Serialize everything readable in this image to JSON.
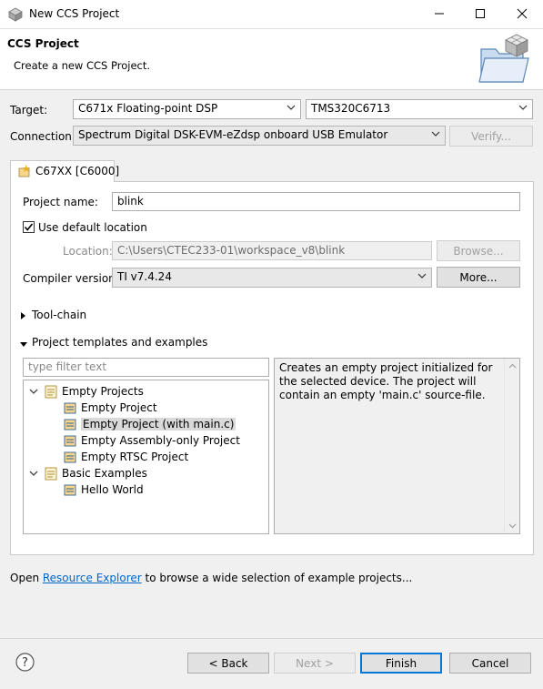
{
  "window": {
    "title": "New CCS Project",
    "minimize_icon": "minimize-icon",
    "maximize_icon": "maximize-icon",
    "close_icon": "close-icon"
  },
  "header": {
    "title": "CCS Project",
    "subtitle": "Create a new CCS Project."
  },
  "target": {
    "label": "Target:",
    "family": "C671x Floating-point DSP",
    "device": "TMS320C6713"
  },
  "connection": {
    "label": "Connection:",
    "value": "Spectrum Digital DSK-EVM-eZdsp onboard USB Emulator",
    "verify_label": "Verify..."
  },
  "tab": {
    "label": "C67XX [C6000]"
  },
  "project": {
    "name_label": "Project name:",
    "name_value": "blink",
    "use_default_label": "Use default location",
    "use_default_checked": true,
    "location_label": "Location:",
    "location_value": "C:\\Users\\CTEC233-01\\workspace_v8\\blink",
    "browse_label": "Browse...",
    "compiler_label": "Compiler version:",
    "compiler_value": "TI v7.4.24",
    "more_label": "More..."
  },
  "sections": {
    "toolchain": "Tool-chain",
    "templates": "Project templates and examples"
  },
  "templates": {
    "filter_placeholder": "type filter text",
    "tree": [
      {
        "label": "Empty Projects",
        "level": 0,
        "expanded": true
      },
      {
        "label": "Empty Project",
        "level": 1
      },
      {
        "label": "Empty Project (with main.c)",
        "level": 1,
        "selected": true
      },
      {
        "label": "Empty Assembly-only Project",
        "level": 1
      },
      {
        "label": "Empty RTSC Project",
        "level": 1
      },
      {
        "label": "Basic Examples",
        "level": 0,
        "expanded": true
      },
      {
        "label": "Hello World",
        "level": 1
      }
    ],
    "description": "Creates an empty project initialized for the selected device. The project will contain an empty 'main.c' source-file."
  },
  "footer": {
    "open_prefix": "Open ",
    "resource_explorer": "Resource Explorer",
    "open_suffix": " to browse a wide selection of example projects...",
    "back_label": "< Back",
    "next_label": "Next >",
    "finish_label": "Finish",
    "cancel_label": "Cancel",
    "help_icon": "help-icon"
  }
}
